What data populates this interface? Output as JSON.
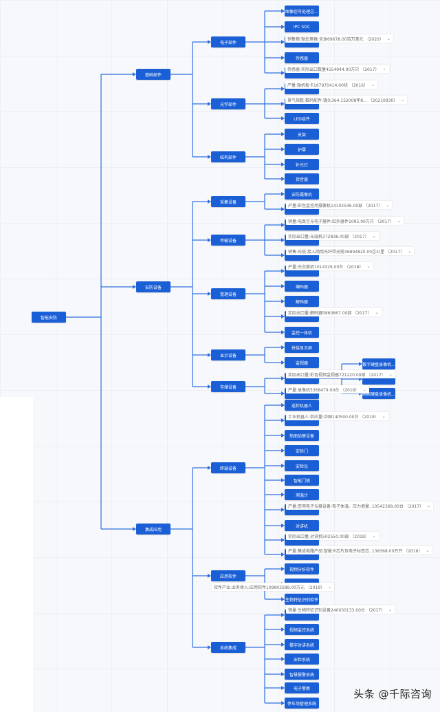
{
  "colors": {
    "node": "#1a5fd6",
    "edge": "#2f6fe0",
    "background": "#f6f8fb"
  },
  "tree": {
    "label": "智能安防",
    "children": [
      {
        "label": "基础部件",
        "children": [
          {
            "label": "电子部件",
            "children": [
              {
                "label": "图像信号处理芯..."
              },
              {
                "label": "IPC SOC"
              },
              {
                "label": ""
              },
              {
                "label": "传感器"
              },
              {
                "label": ""
              }
            ]
          },
          {
            "label": "光学部件",
            "children": [
              {
                "label": ""
              },
              {
                "label": ""
              },
              {
                "label": "LED组件"
              }
            ]
          },
          {
            "label": "结构部件",
            "children": [
              {
                "label": "支架"
              },
              {
                "label": "护罩"
              },
              {
                "label": "补光灯"
              },
              {
                "label": "拾音器"
              }
            ]
          }
        ]
      },
      {
        "label": "安防设备",
        "children": [
          {
            "label": "采集设备",
            "children": [
              {
                "label": "安防摄像机"
              },
              {
                "label": ""
              }
            ]
          },
          {
            "label": "传输设备",
            "children": [
              {
                "label": ""
              },
              {
                "label": ""
              },
              {
                "label": ""
              }
            ]
          },
          {
            "label": "管理设备",
            "children": [
              {
                "label": ""
              },
              {
                "label": "编码器"
              },
              {
                "label": "解码器"
              },
              {
                "label": ""
              },
              {
                "label": "监控一体机"
              }
            ]
          },
          {
            "label": "显示设备",
            "children": [
              {
                "label": "拼接显示屏"
              },
              {
                "label": "监视器"
              }
            ]
          },
          {
            "label": "存储设备",
            "children": [
              {
                "label": "",
                "children": [
                  {
                    "label": "数字硬盘录像机..."
                  },
                  {
                    "label": ""
                  },
                  {
                    "label": "网络硬盘录像机..."
                  }
                ]
              },
              {
                "label": ""
              }
            ]
          }
        ]
      },
      {
        "label": "集成应用",
        "children": [
          {
            "label": "终端设备",
            "children": [
              {
                "label": "巡检机器人"
              },
              {
                "label": ""
              },
              {
                "label": "热图侦察设备"
              },
              {
                "label": "安检门"
              },
              {
                "label": "安检仪"
              },
              {
                "label": "智能门锁"
              },
              {
                "label": "测温计"
              },
              {
                "label": ""
              },
              {
                "label": "对讲机"
              },
              {
                "label": ""
              },
              {
                "label": ""
              }
            ]
          },
          {
            "label": "应用软件",
            "children": [
              {
                "label": "视频分析软件"
              },
              {
                "label": ""
              },
              {
                "label": "生物特征识别软件"
              }
            ]
          },
          {
            "label": "系统集成",
            "children": [
              {
                "label": ""
              },
              {
                "label": "视频监控系统"
              },
              {
                "label": "楼宇对讲系统"
              },
              {
                "label": "安检系统"
              },
              {
                "label": "智慧报警系统"
              },
              {
                "label": "电子警察"
              },
              {
                "label": "停车场管理系统"
              }
            ]
          }
        ]
      }
    ]
  },
  "tooltips": [
    {
      "text": "销售额:微处理器:全球69678.00百万美元 （2020）"
    },
    {
      "text": "传感器:实际出口数量4554944.00万只 （2017）"
    },
    {
      "text": "产量:微机板卡167970414.00块 （2016）"
    },
    {
      "text": "景气指数:数码配件:镜头364.152008年8... （20210930）"
    },
    {
      "text": "产量:彩色监控用摄像机14102536.00部 （2017）"
    },
    {
      "text": "销量:电真空光电子器件:红外器件1095.00万只 （2017）"
    },
    {
      "text": "实际出口量:光端机372838.00部 （2017）"
    },
    {
      "text": "销售:光缆:接入网用光纤带光缆36894820.00芯公里 （2017）"
    },
    {
      "text": "产量:光交换机1014329.00台 （2018）"
    },
    {
      "text": "实际出口量:解码器5860867.00部 （2017）"
    },
    {
      "text": "实际出口量:彩色视频监视器721220.00部 （2017）"
    },
    {
      "text": "产量:录像机5368479.00台 （2016）"
    },
    {
      "text": "工业机器人:供应量:中国140500.00台 （2019）"
    },
    {
      "text": "产量:医用电子仪器设备:电子体温、压力测量..10542368.00台 （2017）"
    },
    {
      "text": "实际出口量:对讲机502550.00部 （2018）"
    },
    {
      "text": "产量:集成电路产品:智能卡芯片及电子标签芯..138368.00万只 （2016）"
    },
    {
      "text": "软件产业:业务收入:应用软件109803588.00万元 （2019）"
    },
    {
      "text": "销量:生物特征识别设备240030133.00台 （2017）"
    }
  ],
  "tooltip_icon": "chevron-down-icon",
  "watermark": "头条 @千际咨询"
}
